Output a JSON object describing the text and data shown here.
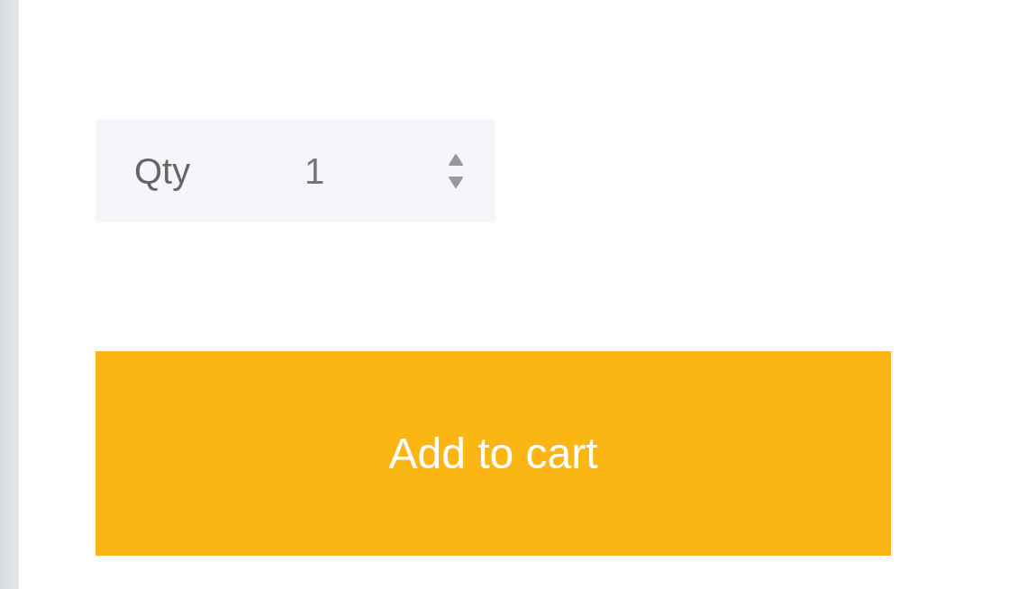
{
  "quantity": {
    "label": "Qty",
    "value": "1"
  },
  "button": {
    "label": "Add to cart"
  }
}
